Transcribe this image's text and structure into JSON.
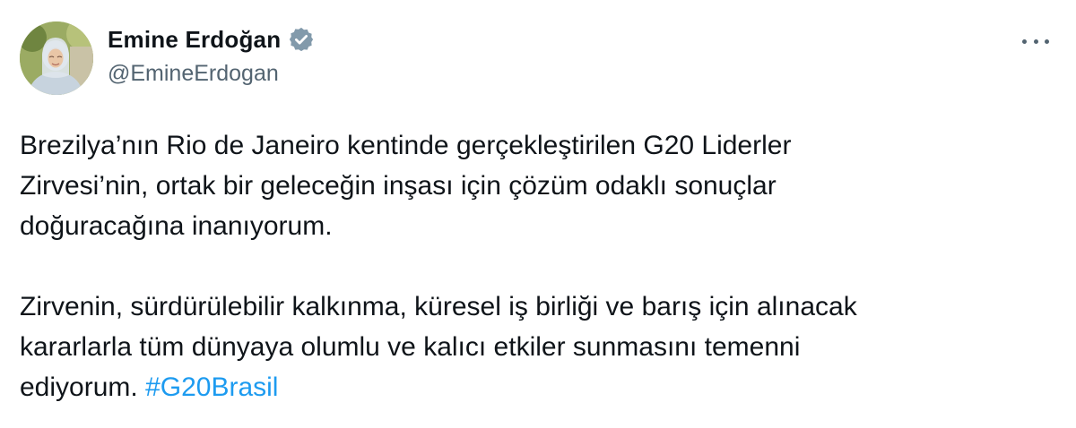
{
  "author": {
    "display_name": "Emine Erdoğan",
    "handle": "@EmineErdogan",
    "verified_icon": "verified-badge-icon",
    "verified_color": "#829aab"
  },
  "menu": {
    "icon": "more-options-icon"
  },
  "tweet": {
    "paragraph1": {
      "line1": "Brezilya’nın Rio de Janeiro kentinde gerçekleştirilen G20 Liderler",
      "line2": "Zirvesi’nin, ortak bir geleceğin inşası için çözüm odaklı sonuçlar",
      "line3": "doğuracağına inanıyorum."
    },
    "paragraph2": {
      "line1": "Zirvenin, sürdürülebilir kalkınma, küresel iş birliği ve barış için alınacak",
      "line2": "kararlarla tüm dünyaya olumlu ve kalıcı etkiler sunmasını temenni",
      "line3_prefix": "ediyorum. ",
      "hashtag": "#G20Brasil"
    }
  },
  "colors": {
    "text": "#0f1419",
    "secondary": "#536471",
    "link": "#1d9bf0"
  }
}
